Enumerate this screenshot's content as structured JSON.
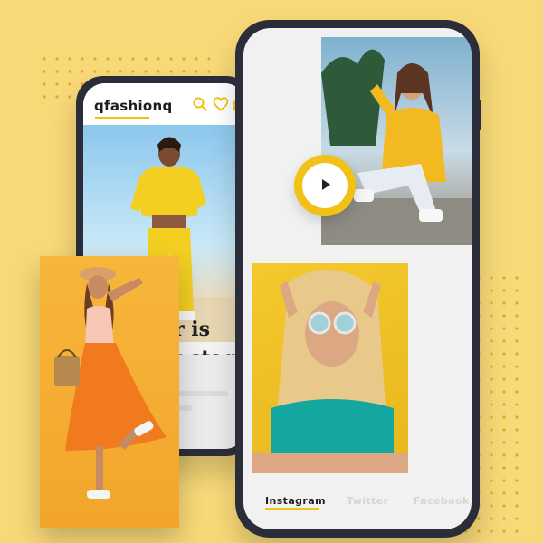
{
  "app": {
    "brand": "qfashionq",
    "hero_caption_lines": [
      "r is",
      "t stag",
      "tacky"
    ]
  },
  "social_tabs": [
    {
      "label": "Instagram",
      "active": true
    },
    {
      "label": "Twitter",
      "active": false
    },
    {
      "label": "Facebook",
      "active": false
    }
  ],
  "video": {
    "play_icon": "play-icon"
  },
  "colors": {
    "background": "#f8d978",
    "accent": "#f2c115",
    "phone_frame": "#2b2d3a",
    "orange_card": "#f2a52b"
  }
}
